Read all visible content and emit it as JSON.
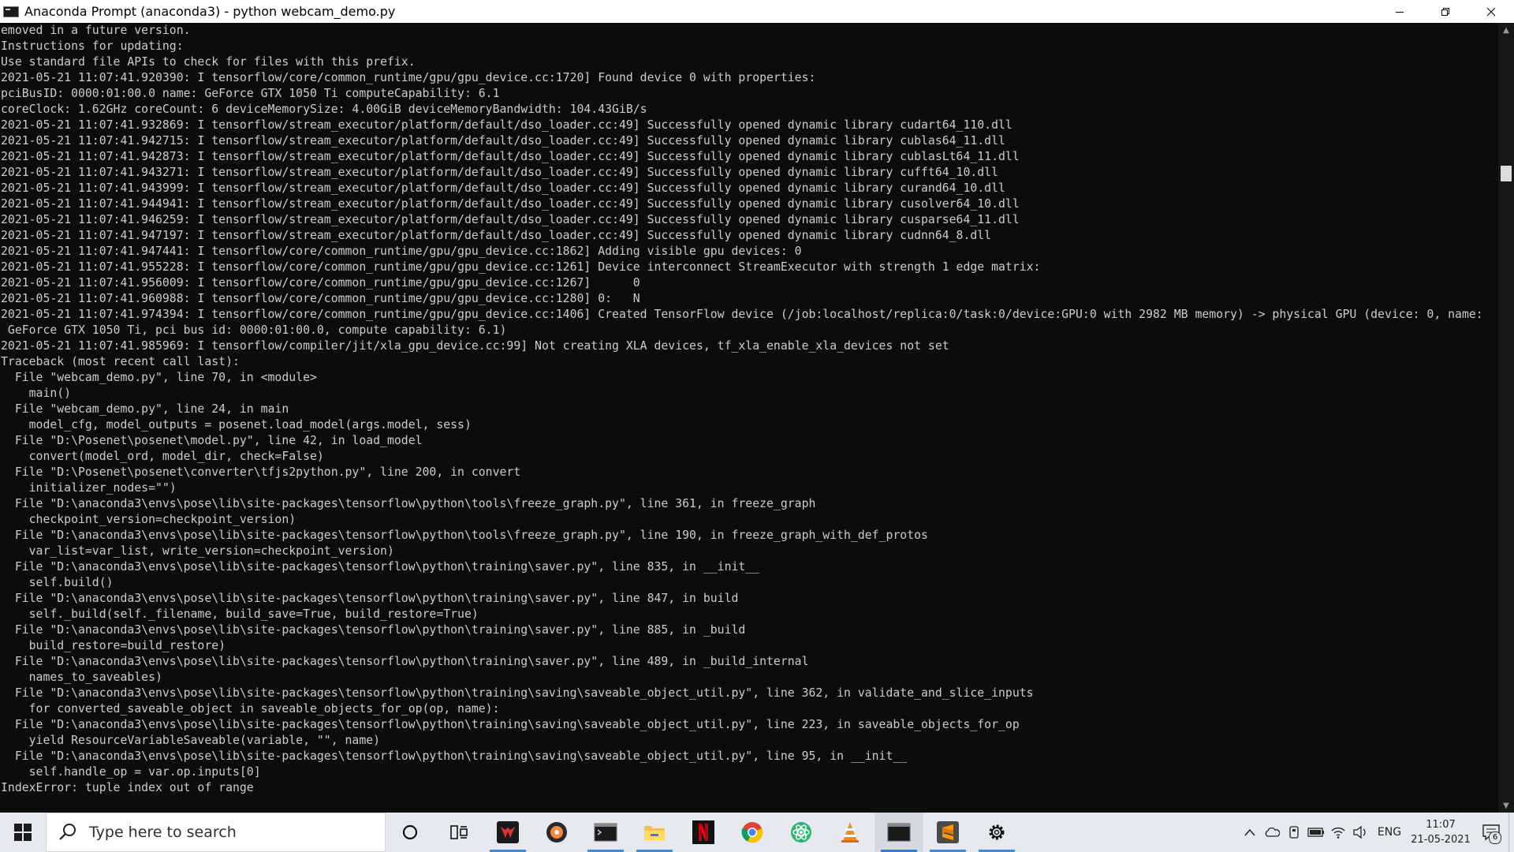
{
  "window": {
    "title": "Anaconda Prompt (anaconda3) - python  webcam_demo.py",
    "controls": [
      "minimize",
      "restore",
      "close"
    ]
  },
  "console": {
    "lines": [
      "emoved in a future version.",
      "Instructions for updating:",
      "Use standard file APIs to check for files with this prefix.",
      "2021-05-21 11:07:41.920390: I tensorflow/core/common_runtime/gpu/gpu_device.cc:1720] Found device 0 with properties:",
      "pciBusID: 0000:01:00.0 name: GeForce GTX 1050 Ti computeCapability: 6.1",
      "coreClock: 1.62GHz coreCount: 6 deviceMemorySize: 4.00GiB deviceMemoryBandwidth: 104.43GiB/s",
      "2021-05-21 11:07:41.932869: I tensorflow/stream_executor/platform/default/dso_loader.cc:49] Successfully opened dynamic library cudart64_110.dll",
      "2021-05-21 11:07:41.942715: I tensorflow/stream_executor/platform/default/dso_loader.cc:49] Successfully opened dynamic library cublas64_11.dll",
      "2021-05-21 11:07:41.942873: I tensorflow/stream_executor/platform/default/dso_loader.cc:49] Successfully opened dynamic library cublasLt64_11.dll",
      "2021-05-21 11:07:41.943271: I tensorflow/stream_executor/platform/default/dso_loader.cc:49] Successfully opened dynamic library cufft64_10.dll",
      "2021-05-21 11:07:41.943999: I tensorflow/stream_executor/platform/default/dso_loader.cc:49] Successfully opened dynamic library curand64_10.dll",
      "2021-05-21 11:07:41.944941: I tensorflow/stream_executor/platform/default/dso_loader.cc:49] Successfully opened dynamic library cusolver64_10.dll",
      "2021-05-21 11:07:41.946259: I tensorflow/stream_executor/platform/default/dso_loader.cc:49] Successfully opened dynamic library cusparse64_11.dll",
      "2021-05-21 11:07:41.947197: I tensorflow/stream_executor/platform/default/dso_loader.cc:49] Successfully opened dynamic library cudnn64_8.dll",
      "2021-05-21 11:07:41.947441: I tensorflow/core/common_runtime/gpu/gpu_device.cc:1862] Adding visible gpu devices: 0",
      "2021-05-21 11:07:41.955228: I tensorflow/core/common_runtime/gpu/gpu_device.cc:1261] Device interconnect StreamExecutor with strength 1 edge matrix:",
      "2021-05-21 11:07:41.956009: I tensorflow/core/common_runtime/gpu/gpu_device.cc:1267]      0",
      "2021-05-21 11:07:41.960988: I tensorflow/core/common_runtime/gpu/gpu_device.cc:1280] 0:   N",
      "2021-05-21 11:07:41.974394: I tensorflow/core/common_runtime/gpu/gpu_device.cc:1406] Created TensorFlow device (/job:localhost/replica:0/task:0/device:GPU:0 with 2982 MB memory) -> physical GPU (device: 0, name:",
      " GeForce GTX 1050 Ti, pci bus id: 0000:01:00.0, compute capability: 6.1)",
      "2021-05-21 11:07:41.985969: I tensorflow/compiler/jit/xla_gpu_device.cc:99] Not creating XLA devices, tf_xla_enable_xla_devices not set",
      "Traceback (most recent call last):",
      "  File \"webcam_demo.py\", line 70, in <module>",
      "    main()",
      "  File \"webcam_demo.py\", line 24, in main",
      "    model_cfg, model_outputs = posenet.load_model(args.model, sess)",
      "  File \"D:\\Posenet\\posenet\\model.py\", line 42, in load_model",
      "    convert(model_ord, model_dir, check=False)",
      "  File \"D:\\Posenet\\posenet\\converter\\tfjs2python.py\", line 200, in convert",
      "    initializer_nodes=\"\")",
      "  File \"D:\\anaconda3\\envs\\pose\\lib\\site-packages\\tensorflow\\python\\tools\\freeze_graph.py\", line 361, in freeze_graph",
      "    checkpoint_version=checkpoint_version)",
      "  File \"D:\\anaconda3\\envs\\pose\\lib\\site-packages\\tensorflow\\python\\tools\\freeze_graph.py\", line 190, in freeze_graph_with_def_protos",
      "    var_list=var_list, write_version=checkpoint_version)",
      "  File \"D:\\anaconda3\\envs\\pose\\lib\\site-packages\\tensorflow\\python\\training\\saver.py\", line 835, in __init__",
      "    self.build()",
      "  File \"D:\\anaconda3\\envs\\pose\\lib\\site-packages\\tensorflow\\python\\training\\saver.py\", line 847, in build",
      "    self._build(self._filename, build_save=True, build_restore=True)",
      "  File \"D:\\anaconda3\\envs\\pose\\lib\\site-packages\\tensorflow\\python\\training\\saver.py\", line 885, in _build",
      "    build_restore=build_restore)",
      "  File \"D:\\anaconda3\\envs\\pose\\lib\\site-packages\\tensorflow\\python\\training\\saver.py\", line 489, in _build_internal",
      "    names_to_saveables)",
      "  File \"D:\\anaconda3\\envs\\pose\\lib\\site-packages\\tensorflow\\python\\training\\saving\\saveable_object_util.py\", line 362, in validate_and_slice_inputs",
      "    for converted_saveable_object in saveable_objects_for_op(op, name):",
      "  File \"D:\\anaconda3\\envs\\pose\\lib\\site-packages\\tensorflow\\python\\training\\saving\\saveable_object_util.py\", line 223, in saveable_objects_for_op",
      "    yield ResourceVariableSaveable(variable, \"\", name)",
      "  File \"D:\\anaconda3\\envs\\pose\\lib\\site-packages\\tensorflow\\python\\training\\saving\\saveable_object_util.py\", line 95, in __init__",
      "    self.handle_op = var.op.inputs[0]",
      "IndexError: tuple index out of range"
    ]
  },
  "taskbar": {
    "search_placeholder": "Type here to search",
    "pinned": [
      {
        "name": "task-view",
        "icon": "task-view-icon"
      },
      {
        "name": "predator-sense",
        "icon": "predator-icon"
      },
      {
        "name": "media-player",
        "icon": "disc-icon"
      },
      {
        "name": "terminal",
        "icon": "terminal-icon"
      },
      {
        "name": "file-explorer",
        "icon": "folder-icon"
      },
      {
        "name": "netflix",
        "icon": "netflix-icon"
      },
      {
        "name": "chrome",
        "icon": "chrome-icon"
      },
      {
        "name": "atom",
        "icon": "atom-icon"
      },
      {
        "name": "vlc",
        "icon": "vlc-icon"
      },
      {
        "name": "anaconda-prompt",
        "icon": "console-icon"
      },
      {
        "name": "sublime-text",
        "icon": "sublime-icon"
      },
      {
        "name": "settings",
        "icon": "gear-icon"
      }
    ],
    "tray": {
      "language": "ENG",
      "time": "11:07",
      "date": "21-05-2021",
      "notification_count": "6"
    }
  },
  "colors": {
    "console_bg": "#0c0c0c",
    "console_fg": "#cccccc",
    "taskbar_bg": "#e6e9f0",
    "accent": "#2c7be5"
  }
}
